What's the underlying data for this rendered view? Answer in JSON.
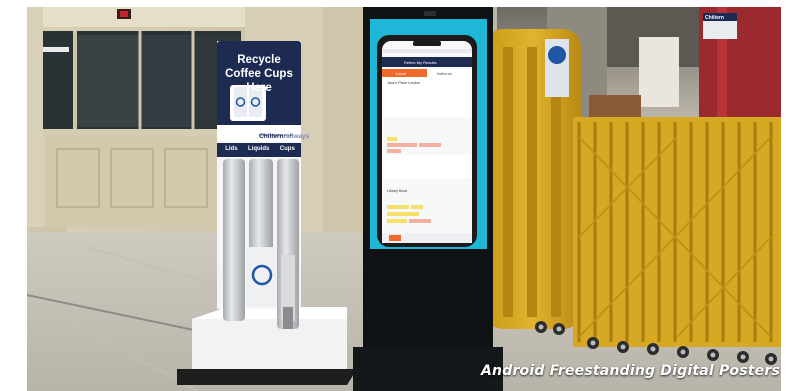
{
  "caption": "Android Freestanding Digital Posters",
  "bin_sign": {
    "title_line1": "Recycle",
    "title_line2": "Coffee Cups",
    "title_line3": "Here",
    "brand": "Chiltern",
    "brand_suffix": "railways",
    "website": "chilternrailways.co.uk",
    "columns": [
      "Lids",
      "Liquids",
      "Cups"
    ]
  },
  "phone_screen": {
    "header_title": "Refine My Results",
    "tab_local": "Local",
    "tab_national": "National",
    "result_1_title": "Jane's Place London",
    "result_2_title": "Library Book"
  },
  "station_sign": "Chiltern",
  "colors": {
    "sign_navy": "#1d2a52",
    "screen_cyan": "#1fb7d8",
    "orange_accent": "#ef6a2b",
    "gate_yellow": "#d6a51e"
  }
}
